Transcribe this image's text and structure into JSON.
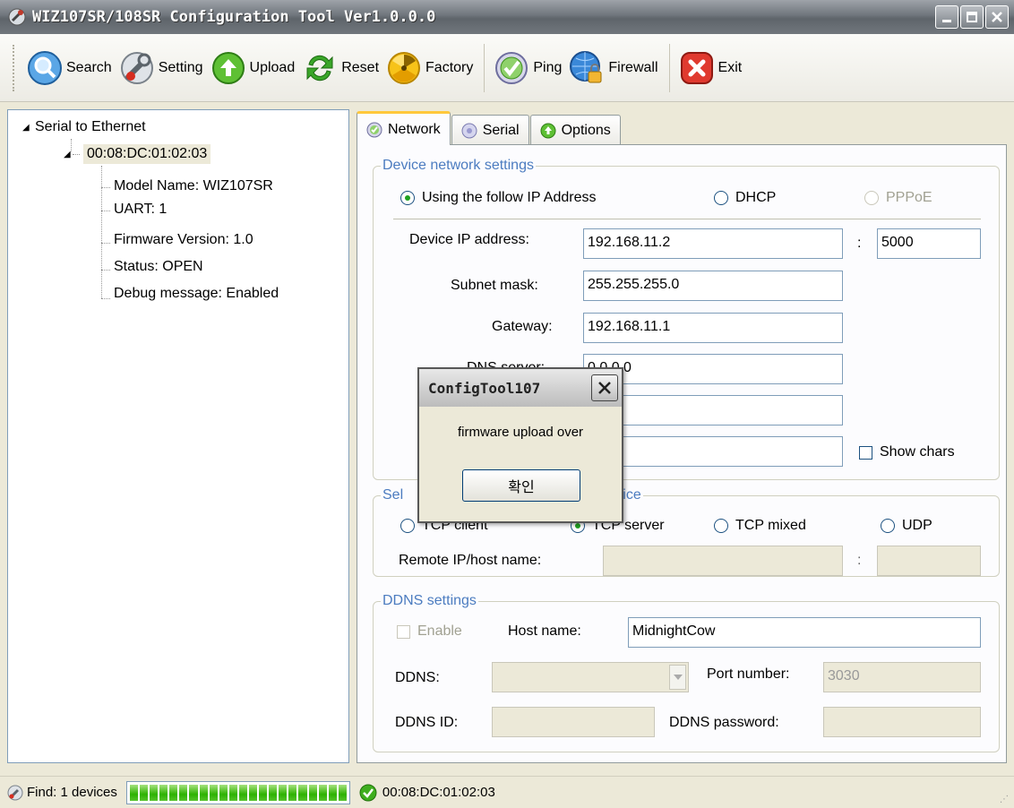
{
  "window": {
    "title": "WIZ107SR/108SR Configuration Tool Ver1.0.0.0",
    "controls": [
      "minimize-icon",
      "maximize-icon",
      "close-icon"
    ]
  },
  "toolbar": {
    "buttons": [
      {
        "label": "Search",
        "icon": "magnifier-icon"
      },
      {
        "label": "Setting",
        "icon": "wrench-icon"
      },
      {
        "label": "Upload",
        "icon": "upload-arrow-icon"
      },
      {
        "label": "Reset",
        "icon": "recycle-icon"
      },
      {
        "label": "Factory",
        "icon": "radiation-icon"
      },
      {
        "label": "Ping",
        "icon": "checkmark-icon"
      },
      {
        "label": "Firewall",
        "icon": "globe-lock-icon"
      },
      {
        "label": "Exit",
        "icon": "close-icon"
      }
    ]
  },
  "tree": {
    "root": "Serial to Ethernet",
    "device": "00:08:DC:01:02:03",
    "details": [
      "Model Name: WIZ107SR",
      "UART: 1",
      "Firmware Version: 1.0",
      "Status: OPEN",
      "Debug message: Enabled"
    ]
  },
  "tabs": [
    {
      "label": "Network",
      "active": true,
      "icon": "network-check-icon"
    },
    {
      "label": "Serial",
      "active": false,
      "icon": "serial-disc-icon"
    },
    {
      "label": "Options",
      "active": false,
      "icon": "options-icon"
    }
  ],
  "network": {
    "legend": "Device network settings",
    "ip_mode": {
      "static_label": "Using the follow IP Address",
      "dhcp_label": "DHCP",
      "pppoe_label": "PPPoE",
      "selected": "static"
    },
    "device_ip_label": "Device IP address:",
    "device_ip": "192.168.11.2",
    "port_sep": ":",
    "port": "5000",
    "subnet_label": "Subnet mask:",
    "subnet": "255.255.255.0",
    "gateway_label": "Gateway:",
    "gateway": "192.168.11.1",
    "dns_label": "DNS server:",
    "dns": "0.0.0.0",
    "show_chars_label": "Show chars"
  },
  "mode": {
    "legend_left": "Sel",
    "legend_right": "e device",
    "options": [
      "TCP client",
      "TCP server",
      "TCP mixed",
      "UDP"
    ],
    "selected": "TCP server",
    "remote_label": "Remote IP/host name:",
    "remote_sep": ":"
  },
  "ddns": {
    "legend": "DDNS settings",
    "enable_label": "Enable",
    "host_label": "Host name:",
    "host": "MidnightCow",
    "ddns_label": "DDNS:",
    "port_label": "Port number:",
    "port": "3030",
    "id_label": "DDNS ID:",
    "password_label": "DDNS password:"
  },
  "dialog": {
    "title": "ConfigTool107",
    "message": "firmware upload over",
    "ok_label": "확인"
  },
  "statusbar": {
    "find_text": "Find: 1 devices",
    "progress": 1.0,
    "device": "00:08:DC:01:02:03"
  }
}
